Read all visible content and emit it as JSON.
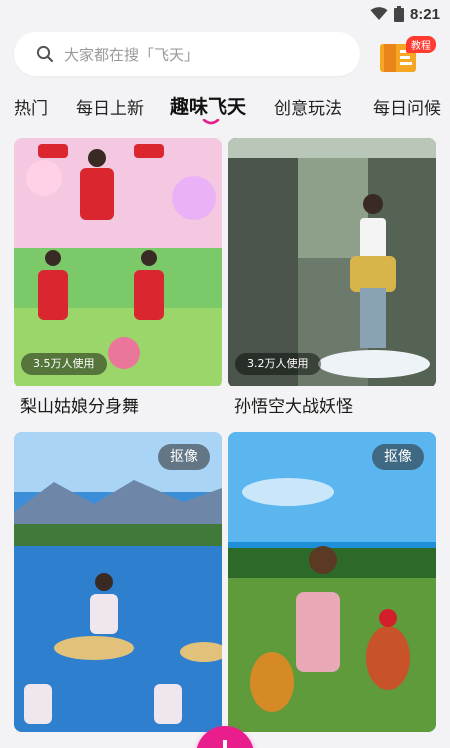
{
  "status_bar": {
    "time": "8:21",
    "icons": [
      "wifi-icon",
      "battery-icon"
    ]
  },
  "search": {
    "placeholder": "大家都在搜「飞天」",
    "icon": "search-icon"
  },
  "tutorial": {
    "badge": "教程",
    "icon": "book-icon"
  },
  "tabs": [
    {
      "label": "热门"
    },
    {
      "label": "每日上新"
    },
    {
      "label": "趣味飞天",
      "active": true
    },
    {
      "label": "创意玩法"
    },
    {
      "label": "每日问候"
    }
  ],
  "cards": [
    {
      "title": "梨山姑娘分身舞",
      "usage": "3.5万人使用"
    },
    {
      "title": "孙悟空大战妖怪",
      "usage": "3.2万人使用"
    },
    {
      "tag": "抠像"
    },
    {
      "tag": "抠像"
    }
  ],
  "colors": {
    "accent": "#e91e8c",
    "background": "#f3f3f5"
  },
  "fab": {
    "icon": "plus-icon"
  }
}
